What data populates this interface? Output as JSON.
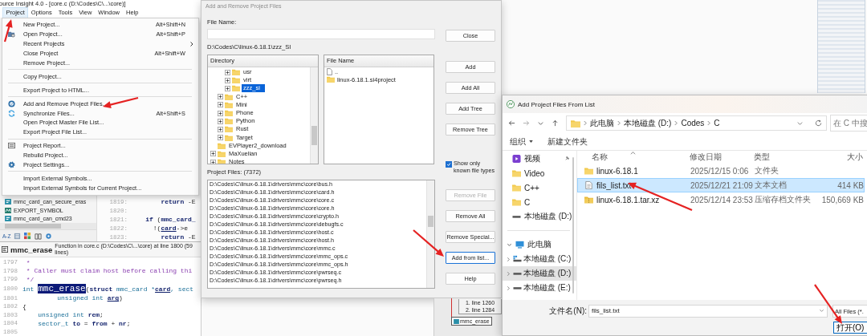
{
  "editor": {
    "title": "ource Insight 4.0 - [core.c (D:\\Codes\\C\\...\\core)]",
    "menu_bar": [
      {
        "label": "Project",
        "selected": true
      },
      {
        "label": "Options",
        "selected": false
      },
      {
        "label": "Tools",
        "selected": false
      },
      {
        "label": "View",
        "selected": false
      },
      {
        "label": "Window",
        "selected": false
      },
      {
        "label": "Help",
        "selected": false
      }
    ],
    "symbols": [
      {
        "name": "mmc_card_can_secure_eras",
        "kind": "function"
      },
      {
        "name": "EXPORT_SYMBOL",
        "kind": "macro"
      },
      {
        "name": "mmc_card_can_cmd23",
        "kind": "function"
      }
    ],
    "sort_label": "A-Z",
    "upper_code": [
      {
        "number": "1819:",
        "tokens": [
          {
            "text": "        return",
            "kind": "keyword"
          },
          {
            "text": " -E",
            "kind": "plain"
          }
        ]
      },
      {
        "number": "1820:"
      },
      {
        "number": "1821:",
        "tokens": [
          {
            "text": "    if",
            "kind": "keyword"
          },
          {
            "text": " (",
            "kind": "plain"
          },
          {
            "text": "mmc_card_",
            "kind": "call"
          }
        ]
      },
      {
        "number": "1822:",
        "tokens": [
          {
            "text": "      !(",
            "kind": "plain"
          },
          {
            "text": "card",
            "kind": "param"
          },
          {
            "text": "->e",
            "kind": "plain"
          }
        ]
      },
      {
        "number": "1823:",
        "tokens": [
          {
            "text": "        return",
            "kind": "keyword"
          },
          {
            "text": " -E",
            "kind": "plain"
          }
        ]
      }
    ],
    "function_bar": {
      "name": "mmc_erase",
      "description": "Function in core.c (D:\\Codes\\C\\...\\core) at line 1800 (59 lines)"
    },
    "code_lines": [
      {
        "number": "1797",
        "tokens": [
          {
            "text": " *",
            "kind": "comment"
          }
        ]
      },
      {
        "number": "1798",
        "tokens": [
          {
            "text": " * Caller must claim host before calling thi",
            "kind": "comment"
          }
        ]
      },
      {
        "number": "1799",
        "tokens": [
          {
            "text": " */",
            "kind": "comment"
          }
        ]
      },
      {
        "number": "1800",
        "tokens": [
          {
            "text": "int ",
            "kind": "type"
          },
          {
            "text": "mmc_erase",
            "kind": "highlight"
          },
          {
            "text": "(",
            "kind": "plain"
          },
          {
            "text": "struct",
            "kind": "keyword"
          },
          {
            "text": " mmc_card *",
            "kind": "type"
          },
          {
            "text": "card",
            "kind": "param"
          },
          {
            "text": ", sect",
            "kind": "type"
          }
        ]
      },
      {
        "number": "1801",
        "tokens": [
          {
            "text": "         unsigned int ",
            "kind": "type"
          },
          {
            "text": "arg",
            "kind": "param"
          },
          {
            "text": ")",
            "kind": "plain"
          }
        ]
      },
      {
        "number": "1802",
        "tokens": [
          {
            "text": "{",
            "kind": "plain"
          }
        ]
      },
      {
        "number": "1803",
        "tokens": [
          {
            "text": "    unsigned int ",
            "kind": "type"
          },
          {
            "text": "rem",
            "kind": "var"
          },
          {
            "text": ";",
            "kind": "plain"
          }
        ]
      },
      {
        "number": "1804",
        "tokens": [
          {
            "text": "    sector_t ",
            "kind": "type"
          },
          {
            "text": "to",
            "kind": "var"
          },
          {
            "text": " = ",
            "kind": "plain"
          },
          {
            "text": "from",
            "kind": "var"
          },
          {
            "text": " + ",
            "kind": "plain"
          },
          {
            "text": "nr",
            "kind": "var"
          },
          {
            "text": ";",
            "kind": "plain"
          }
        ]
      },
      {
        "number": "1805"
      }
    ]
  },
  "project_menu": {
    "groups": [
      [
        {
          "label": "New Project...",
          "shortcut": "Alt+Shift+N",
          "submenu": false
        },
        {
          "label": "Open Project...",
          "shortcut": "Alt+Shift+P",
          "submenu": false
        },
        {
          "label": "Recent Projects",
          "submenu": true
        },
        {
          "label": "Close Project",
          "shortcut": "Alt+Shift+W",
          "submenu": false
        },
        {
          "label": "Remove Project...",
          "submenu": false
        }
      ],
      [
        {
          "label": "Copy Project...",
          "submenu": false
        }
      ],
      [
        {
          "label": "Export Project to HTML...",
          "submenu": false
        }
      ],
      [
        {
          "label": "Add and Remove Project Files...",
          "submenu": false
        },
        {
          "label": "Synchronize Files...",
          "shortcut": "Alt+Shift+S",
          "submenu": false
        },
        {
          "label": "Open Project Master File List...",
          "submenu": false
        },
        {
          "label": "Export Project File List...",
          "submenu": false
        }
      ],
      [
        {
          "label": "Project Report...",
          "submenu": false
        },
        {
          "label": "Rebuild Project...",
          "submenu": false
        },
        {
          "label": "Project Settings...",
          "submenu": false
        }
      ],
      [
        {
          "label": "Import External Symbols...",
          "submenu": false
        },
        {
          "label": "Import External Symbols for Current Project...",
          "submenu": false
        }
      ]
    ]
  },
  "project_dialog": {
    "title": "Add and Remove Project Files",
    "file_name_label": "File Name:",
    "current_path": "D:\\Codes\\C\\linux-6.18.1\\zzz_SI",
    "directory": {
      "heading": "Directory",
      "items": [
        {
          "children": [
            {
              "children": [
                {
                  "label": "usr",
                  "expanded": false,
                  "selected": false
                },
                {
                  "label": "virt",
                  "expanded": false,
                  "selected": false
                },
                {
                  "label": "zzz_si",
                  "expanded": false,
                  "selected": true
                }
              ]
            },
            {
              "label": "C++",
              "expanded": false,
              "selected": false
            },
            {
              "label": "Mini",
              "expanded": false,
              "selected": false
            },
            {
              "label": "Phone",
              "expanded": false,
              "selected": false
            },
            {
              "label": "Python",
              "expanded": false,
              "selected": false
            },
            {
              "label": "Rust",
              "expanded": false,
              "selected": false
            },
            {
              "label": "Target",
              "expanded": false,
              "selected": false
            }
          ]
        },
        {
          "label": "EVPlayer2_download",
          "selected": false
        },
        {
          "label": "MaXuelian",
          "expanded": false,
          "selected": false
        },
        {
          "label": "Notes",
          "expanded": false,
          "selected": false
        }
      ]
    },
    "files": {
      "heading": "File Name",
      "items": [
        {
          "name": "..",
          "kind": "parent"
        },
        {
          "name": "linux-6.18.1.si4project",
          "kind": "folder"
        }
      ]
    },
    "close_button": "Close",
    "add_buttons": [
      {
        "label": "Add",
        "disabled": false
      },
      {
        "label": "Add All",
        "disabled": false
      },
      {
        "label": "Add Tree",
        "disabled": false
      },
      {
        "label": "Remove Tree",
        "disabled": false
      }
    ],
    "known_types": {
      "label": "Show only known file types",
      "checked": true
    },
    "project_files_label": "Project Files: (7372)",
    "project_files": [
      "D:\\Codes\\C\\linux-6.18.1\\drivers\\mmc\\core\\bus.h",
      "D:\\Codes\\C\\linux-6.18.1\\drivers\\mmc\\core\\card.h",
      "D:\\Codes\\C\\linux-6.18.1\\drivers\\mmc\\core\\core.c",
      "D:\\Codes\\C\\linux-6.18.1\\drivers\\mmc\\core\\core.h",
      "D:\\Codes\\C\\linux-6.18.1\\drivers\\mmc\\core\\crypto.h",
      "D:\\Codes\\C\\linux-6.18.1\\drivers\\mmc\\core\\debugfs.c",
      "D:\\Codes\\C\\linux-6.18.1\\drivers\\mmc\\core\\host.c",
      "D:\\Codes\\C\\linux-6.18.1\\drivers\\mmc\\core\\host.h",
      "D:\\Codes\\C\\linux-6.18.1\\drivers\\mmc\\core\\mmc.c",
      "D:\\Codes\\C\\linux-6.18.1\\drivers\\mmc\\core\\mmc_ops.c",
      "D:\\Codes\\C\\linux-6.18.1\\drivers\\mmc\\core\\mmc_ops.h",
      "D:\\Codes\\C\\linux-6.18.1\\drivers\\mmc\\core\\pwrseq.c",
      "D:\\Codes\\C\\linux-6.18.1\\drivers\\mmc\\core\\pwrseq.h"
    ],
    "file_buttons": [
      {
        "label": "Remove File",
        "disabled": true,
        "focused": false
      },
      {
        "label": "Remove All",
        "disabled": false,
        "focused": false
      },
      {
        "label": "Remove Special...",
        "disabled": false,
        "focused": false
      },
      {
        "label": "Add from list...",
        "disabled": false,
        "focused": true
      },
      {
        "label": "Help",
        "disabled": false,
        "focused": false
      }
    ]
  },
  "relation_window": {
    "entries": [
      "1. line 1260",
      "2. line 1284"
    ],
    "node": "mmc_erase"
  },
  "file_dialog": {
    "title": "Add Project Files From List",
    "breadcrumb": [
      "此电脑",
      "本地磁盘 (D:)",
      "Codes",
      "C"
    ],
    "search_placeholder": "在 C 中搜",
    "toolbar": [
      {
        "label": "组织",
        "dropdown": true
      },
      {
        "label": "新建文件夹",
        "dropdown": false
      }
    ],
    "quick_access": [
      {
        "label": "视频",
        "kind": "video",
        "pinned": true
      },
      {
        "label": "Video",
        "kind": "folder",
        "pinned": false
      },
      {
        "label": "C++",
        "kind": "folder",
        "pinned": false
      },
      {
        "label": "C",
        "kind": "folder",
        "pinned": false
      },
      {
        "label": "本地磁盘 (D:)",
        "kind": "drive",
        "pinned": false
      }
    ],
    "nav_tree": [
      {
        "label": "此电脑",
        "kind": "computer",
        "expanded": true,
        "selected": false,
        "children": [
          {
            "label": "本地磁盘 (C:)",
            "kind": "system-drive",
            "expanded": false,
            "selected": false
          },
          {
            "label": "本地磁盘 (D:)",
            "kind": "drive",
            "expanded": false,
            "selected": true
          },
          {
            "label": "本地磁盘 (E:)",
            "kind": "drive",
            "expanded": false,
            "selected": false
          }
        ]
      }
    ],
    "columns": [
      {
        "label": "名称",
        "sorted": true
      },
      {
        "label": "修改日期",
        "sorted": false
      },
      {
        "label": "类型",
        "sorted": false
      },
      {
        "label": "大小",
        "sorted": false
      }
    ],
    "rows": [
      {
        "name": "linux-6.18.1",
        "modified": "2025/12/15 0:06",
        "type": "文件夹",
        "kind": "folder",
        "selected": false
      },
      {
        "name": "fils_list.txt",
        "modified": "2025/12/21 21:09",
        "type": "文本文档",
        "size": "414 KB",
        "kind": "text",
        "selected": true
      },
      {
        "name": "linux-6.18.1.tar.xz",
        "modified": "2025/12/14 23:53",
        "type": "压缩存档文件夹",
        "size": "150,669 KB",
        "kind": "archive",
        "selected": false
      }
    ],
    "file_name_label": "文件名(N):",
    "file_name": "fils_list.txt",
    "filter": "All Files (*.",
    "open_button": "打开(O)"
  }
}
